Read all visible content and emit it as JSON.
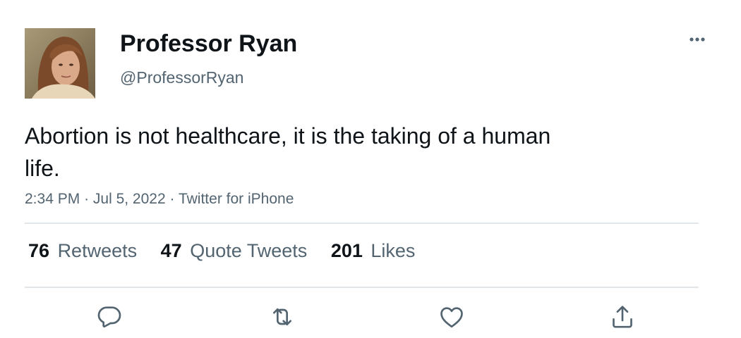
{
  "author": {
    "display_name": "Professor Ryan",
    "handle": "@ProfessorRyan",
    "avatar_icon": "profile-photo"
  },
  "more_icon": "more-horizontal-icon",
  "tweet": {
    "text": "Abortion is not healthcare, it is the taking of a human life.",
    "time": "2:34 PM",
    "date": "Jul 5, 2022",
    "source": "Twitter for iPhone",
    "separator": "·"
  },
  "stats": {
    "retweets": {
      "count": "76",
      "label": "Retweets"
    },
    "quote_tweets": {
      "count": "47",
      "label": "Quote Tweets"
    },
    "likes": {
      "count": "201",
      "label": "Likes"
    }
  },
  "actions": {
    "reply_icon": "reply-icon",
    "retweet_icon": "retweet-icon",
    "like_icon": "heart-icon",
    "share_icon": "share-icon"
  },
  "colors": {
    "text_primary": "#0f1419",
    "text_secondary": "#536471",
    "divider": "#e1e6ea"
  }
}
